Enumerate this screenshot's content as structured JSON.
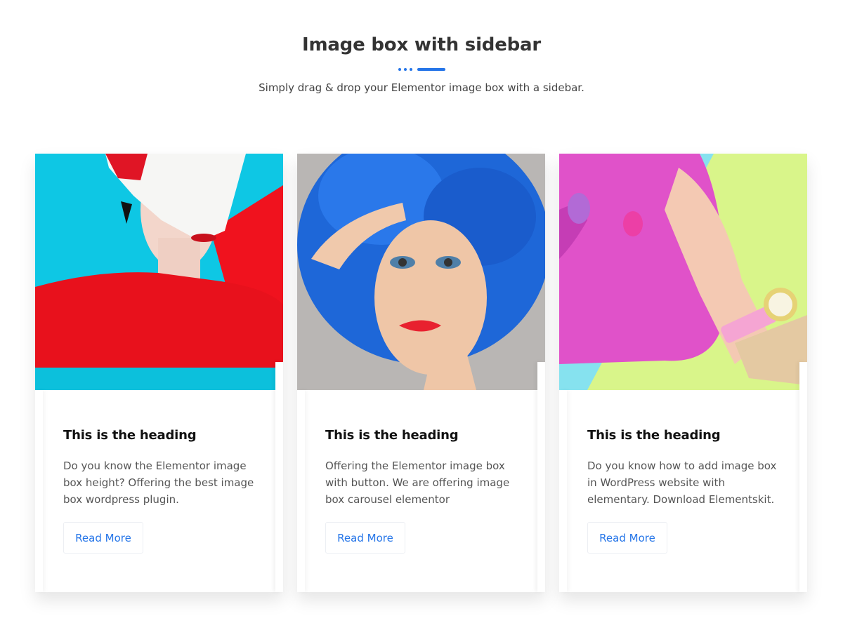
{
  "header": {
    "title": "Image box with sidebar",
    "subtitle": "Simply drag & drop your Elementor image box with a sidebar."
  },
  "colors": {
    "accent": "#2575e8"
  },
  "cards": [
    {
      "heading": "This is the heading",
      "description": "Do you know the Elementor image box height? Offering the best image box wordpress plugin.",
      "button_label": "Read More",
      "image_icon": "portrait-red-sweater-white-hair"
    },
    {
      "heading": "This is the heading",
      "description": "Offering the Elementor image box with button. We are offering image box carousel elementor",
      "button_label": "Read More",
      "image_icon": "portrait-blue-curly-hair"
    },
    {
      "heading": "This is the heading",
      "description": "Do you know how to add image box in WordPress website with elementary. Download Elementskit.",
      "button_label": "Read More",
      "image_icon": "pink-clutch-bag-hand"
    }
  ]
}
